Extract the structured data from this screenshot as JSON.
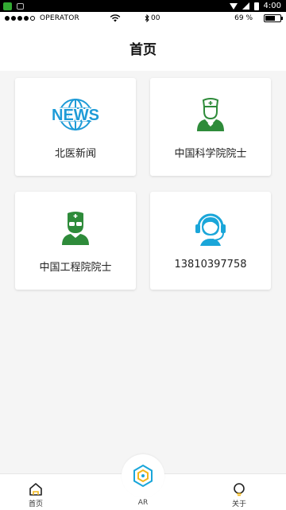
{
  "system_bar": {
    "time": "4:00"
  },
  "status_bar": {
    "carrier": "OPERATOR",
    "bluetooth": "00",
    "battery_percent": "69 %",
    "battery_level": 0.69
  },
  "header": {
    "title": "首页"
  },
  "cards": [
    {
      "label": "北医新闻",
      "icon": "news-globe-icon",
      "icon_text": "NEWS",
      "color": "#1e9bd7"
    },
    {
      "label": "中国科学院院士",
      "icon": "doctor-icon",
      "color": "#2e8b3a"
    },
    {
      "label": "中国工程院院士",
      "icon": "doctor-glasses-icon",
      "color": "#2e8b3a"
    },
    {
      "label": "13810397758",
      "icon": "headset-support-icon",
      "color": "#1aa6d9"
    }
  ],
  "tabbar": {
    "home": {
      "label": "首页",
      "icon": "home-icon"
    },
    "ar": {
      "label": "AR",
      "icon": "ar-hexagon-icon"
    },
    "about": {
      "label": "关于",
      "icon": "bulb-icon"
    }
  },
  "colors": {
    "accent_blue": "#1e9bd7",
    "accent_green": "#2e8b3a",
    "ar_yellow": "#f2b81d"
  }
}
